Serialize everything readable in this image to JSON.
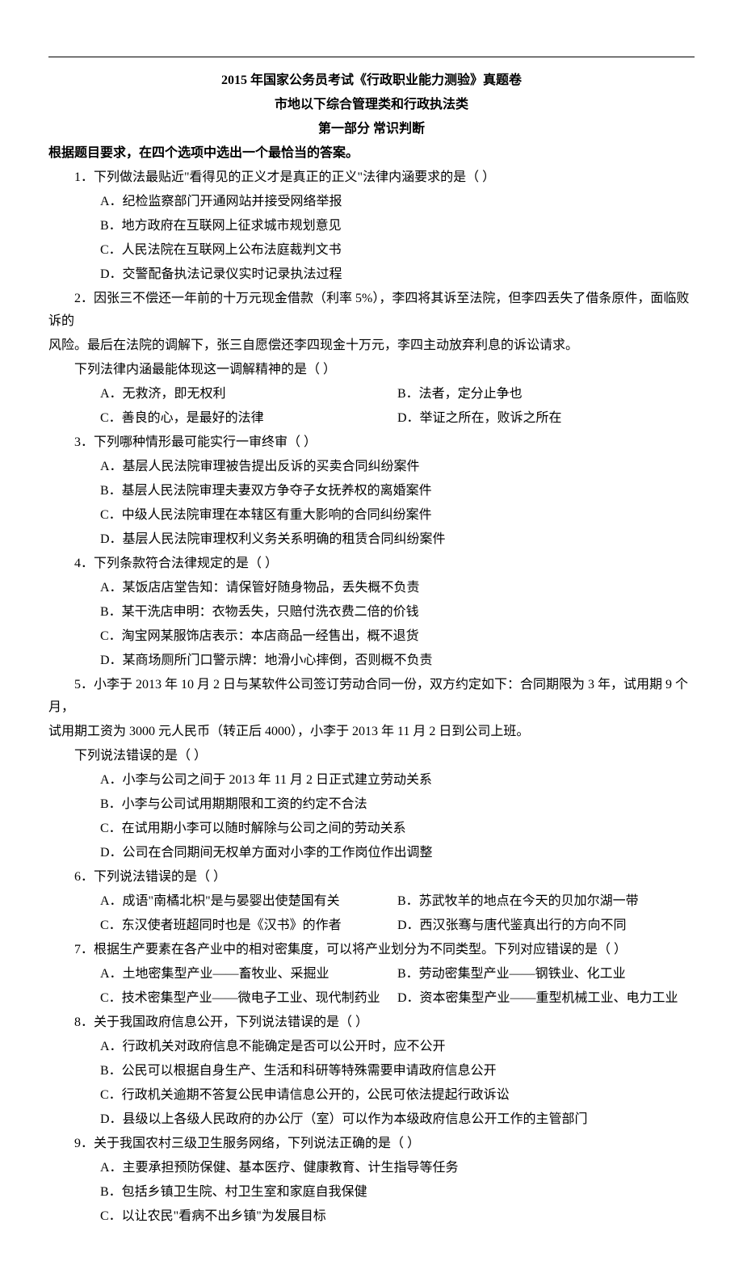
{
  "header": {
    "title": "2015 年国家公务员考试《行政职业能力测验》真题卷",
    "subtitle": "市地以下综合管理类和行政执法类",
    "section": "第一部分  常识判断",
    "instruction": "根据题目要求，在四个选项中选出一个最恰当的答案。"
  },
  "q1": {
    "stem": "1．下列做法最贴近\"看得见的正义才是真正的正义\"法律内涵要求的是（   ）",
    "A": "A．纪检监察部门开通网站并接受网络举报",
    "B": "B．地方政府在互联网上征求城市规划意见",
    "C": "C．人民法院在互联网上公布法庭裁判文书",
    "D": "D．交警配备执法记录仪实时记录执法过程"
  },
  "q2": {
    "stem1": "2．因张三不偿还一年前的十万元现金借款（利率 5%），李四将其诉至法院，但李四丢失了借条原件，面临败诉的",
    "stem2": "风险。最后在法院的调解下，张三自愿偿还李四现金十万元，李四主动放弃利息的诉讼请求。",
    "sub": "下列法律内涵最能体现这一调解精神的是（   ）",
    "A": "A．无救济，即无权利",
    "B": "B．法者，定分止争也",
    "C": "C．善良的心，是最好的法律",
    "D": "D．举证之所在，败诉之所在"
  },
  "q3": {
    "stem": "3．下列哪种情形最可能实行一审终审（   ）",
    "A": "A．基层人民法院审理被告提出反诉的买卖合同纠纷案件",
    "B": "B．基层人民法院审理夫妻双方争夺子女抚养权的离婚案件",
    "C": "C．中级人民法院审理在本辖区有重大影响的合同纠纷案件",
    "D": "D．基层人民法院审理权利义务关系明确的租赁合同纠纷案件"
  },
  "q4": {
    "stem": "4．下列条款符合法律规定的是（   ）",
    "A": "A．某饭店店堂告知：请保管好随身物品，丢失概不负责",
    "B": "B．某干洗店申明：衣物丢失，只赔付洗衣费二倍的价钱",
    "C": "C．淘宝网某服饰店表示：本店商品一经售出，概不退货",
    "D": "D．某商场厕所门口警示牌：地滑小心摔倒，否则概不负责"
  },
  "q5": {
    "stem1": "5．小李于 2013 年 10 月 2 日与某软件公司签订劳动合同一份，双方约定如下：合同期限为 3 年，试用期 9 个月，",
    "stem2": "试用期工资为 3000 元人民币（转正后 4000），小李于 2013 年 11 月 2 日到公司上班。",
    "sub": "下列说法错误的是（   ）",
    "A": "A．小李与公司之间于 2013 年 11 月 2 日正式建立劳动关系",
    "B": "B．小李与公司试用期期限和工资的约定不合法",
    "C": "C．在试用期小李可以随时解除与公司之间的劳动关系",
    "D": "D．公司在合同期间无权单方面对小李的工作岗位作出调整"
  },
  "q6": {
    "stem": "6．下列说法错误的是（   ）",
    "A": "A．成语\"南橘北枳\"是与晏婴出使楚国有关",
    "B": "B．苏武牧羊的地点在今天的贝加尔湖一带",
    "C": "C．东汉使者班超同时也是《汉书》的作者",
    "D": "D．西汉张骞与唐代鉴真出行的方向不同"
  },
  "q7": {
    "stem": "7．根据生产要素在各产业中的相对密集度，可以将产业划分为不同类型。下列对应错误的是（   ）",
    "A": "A．土地密集型产业——畜牧业、采掘业",
    "B": "B．劳动密集型产业——钢铁业、化工业",
    "C": "C．技术密集型产业——微电子工业、现代制药业",
    "D": "D．资本密集型产业——重型机械工业、电力工业"
  },
  "q8": {
    "stem": "8．关于我国政府信息公开，下列说法错误的是（   ）",
    "A": "A．行政机关对政府信息不能确定是否可以公开时，应不公开",
    "B": "B．公民可以根据自身生产、生活和科研等特殊需要申请政府信息公开",
    "C": "C．行政机关逾期不答复公民申请信息公开的，公民可依法提起行政诉讼",
    "D": "D．县级以上各级人民政府的办公厅（室）可以作为本级政府信息公开工作的主管部门"
  },
  "q9": {
    "stem": "9．关于我国农村三级卫生服务网络，下列说法正确的是（   ）",
    "A": "A．主要承担预防保健、基本医疗、健康教育、计生指导等任务",
    "B": "B．包括乡镇卫生院、村卫生室和家庭自我保健",
    "C": "C．以让农民\"看病不出乡镇\"为发展目标"
  }
}
